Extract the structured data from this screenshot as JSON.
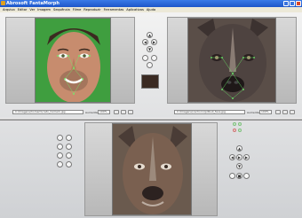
{
  "window": {
    "title": "Abrosoft FantaMorph"
  },
  "menu": [
    "Arquivo",
    "Editar",
    "Ver",
    "Imagem",
    "Sequência",
    "Filme",
    "Reproduzir",
    "Ferramentas",
    "Aplicativos",
    "Ajuda"
  ],
  "left_panel": {
    "path": "C:\\Imagens\\homem\\rosto_homem.jpg",
    "zoom_label": "Aumentar",
    "zoom_value": "100%",
    "mode": "Fundo"
  },
  "right_panel": {
    "path": "C:\\Imagens\\cachorro\\pitbull_face.jpg",
    "zoom_label": "Aumentar",
    "zoom_value": "100%",
    "mode": "Fundo"
  },
  "controls": {
    "arrows": [
      "▲",
      "◀",
      "▶",
      "▼"
    ],
    "play": "▶",
    "stop": "■"
  },
  "icons": {
    "app": "app-icon",
    "minimize": "minimize-icon",
    "maximize": "maximize-icon",
    "close": "close-icon"
  }
}
